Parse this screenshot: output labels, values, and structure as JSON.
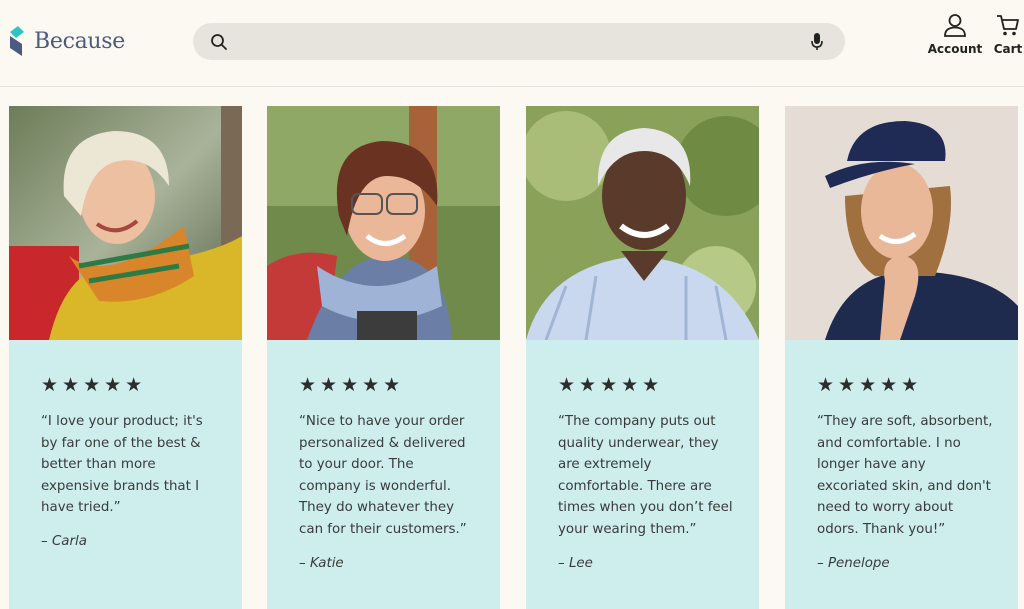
{
  "header": {
    "logo_text": "Because",
    "search": {
      "value": "",
      "placeholder": ""
    },
    "account_label": "Account",
    "cart_label": "Cart"
  },
  "icons": {
    "search": "search-icon",
    "microphone": "microphone-icon",
    "account": "person-icon",
    "cart": "cart-icon"
  },
  "colors": {
    "background": "#fbf9f1",
    "card": "#cdeeed",
    "brand_navy": "#4b5a80",
    "brand_teal": "#2ec4c4"
  },
  "testimonials": [
    {
      "rating": 5,
      "stars": "★★★★★",
      "quote": "“I love your product; it's by far one of the best & better than more expensive brands that I have tried.”",
      "author": "– Carla"
    },
    {
      "rating": 5,
      "stars": "★★★★★",
      "quote": "“Nice to have your order personalized & delivered to your door. The company is wonderful. They do whatever they can for their customers.”",
      "author": "– Katie"
    },
    {
      "rating": 5,
      "stars": "★★★★★",
      "quote": "“The company puts out quality underwear, they are extremely comfortable. There are times when you don’t feel your wearing them.”",
      "author": "– Lee"
    },
    {
      "rating": 5,
      "stars": "★★★★★",
      "quote": "“They are soft, absorbent, and comfortable. I no longer have any excoriated skin, and don't need to worry about odors. Thank you!”",
      "author": "– Penelope"
    }
  ]
}
